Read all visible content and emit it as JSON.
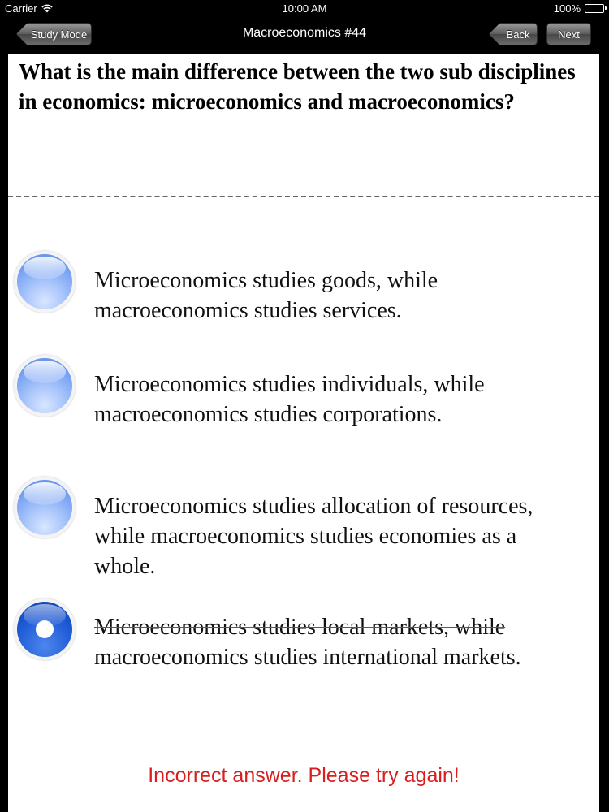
{
  "status_bar": {
    "carrier": "Carrier",
    "time": "10:00 AM",
    "battery": "100%",
    "icons": [
      "wifi-icon",
      "battery-icon"
    ]
  },
  "nav": {
    "study_mode": "Study Mode",
    "title": "Macroeconomics #44",
    "back": "Back",
    "next": "Next"
  },
  "question": {
    "text": "What is the main difference between the two sub disciplines in economics: microeconomics and macroeconomics?"
  },
  "options": [
    {
      "line1": "Microeconomics studies goods, while",
      "line2": "macroeconomics studies services.",
      "selected": false
    },
    {
      "line1": "Microeconomics studies individuals, while",
      "line2": "macroeconomics studies corporations.",
      "selected": false
    },
    {
      "line1": "Microeconomics studies allocation of resources,",
      "line2": "while macroeconomics studies economies as a",
      "line3": "whole.",
      "selected": false
    },
    {
      "line1": "Microeconomics studies local markets, while",
      "line2": "macroeconomics studies international markets.",
      "selected": true,
      "struck_line1": true
    }
  ],
  "feedback": {
    "text": "Incorrect answer. Please try again!",
    "color": "#d81e1e"
  },
  "colors": {
    "radio_unselected": "#8fb2f7",
    "radio_selected": "#1e5bd6",
    "strike": "#dd2222"
  }
}
